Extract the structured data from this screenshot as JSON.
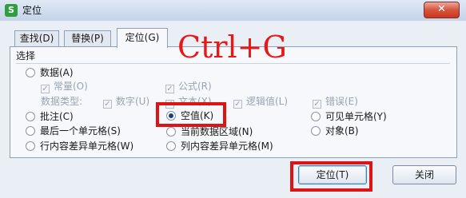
{
  "window": {
    "app_icon_letter": "S",
    "title": "定位",
    "close_glyph": "✕"
  },
  "tabs": [
    {
      "label": "查找(D)",
      "active": false
    },
    {
      "label": "替换(P)",
      "active": false
    },
    {
      "label": "定位(G)",
      "active": true
    }
  ],
  "group_label": "选择",
  "options": {
    "data": "数据(A)",
    "constant": "常量(O)",
    "formula": "公式(R)",
    "data_type_label": "数据类型:",
    "number": "数字(U)",
    "text": "文本(X)",
    "logical": "逻辑值(L)",
    "error": "错误(E)",
    "comment": "批注(C)",
    "blank": "空值(K)",
    "visible_cells": "可见单元格(Y)",
    "last_cell": "最后一个单元格(S)",
    "current_region": "当前数据区域(N)",
    "object": "对象(B)",
    "row_diff": "行内容差异单元格(W)",
    "col_diff": "列内容差异单元格(M)",
    "selected": "blank"
  },
  "buttons": {
    "locate": "定位(T)",
    "close": "关闭"
  },
  "annotation": {
    "shortcut": "Ctrl+G",
    "color": "#e81818"
  },
  "colors": {
    "highlight_box": "#dd1414",
    "dialog_bg": "#eaeef5",
    "titlebar_close": "#c7381f"
  }
}
